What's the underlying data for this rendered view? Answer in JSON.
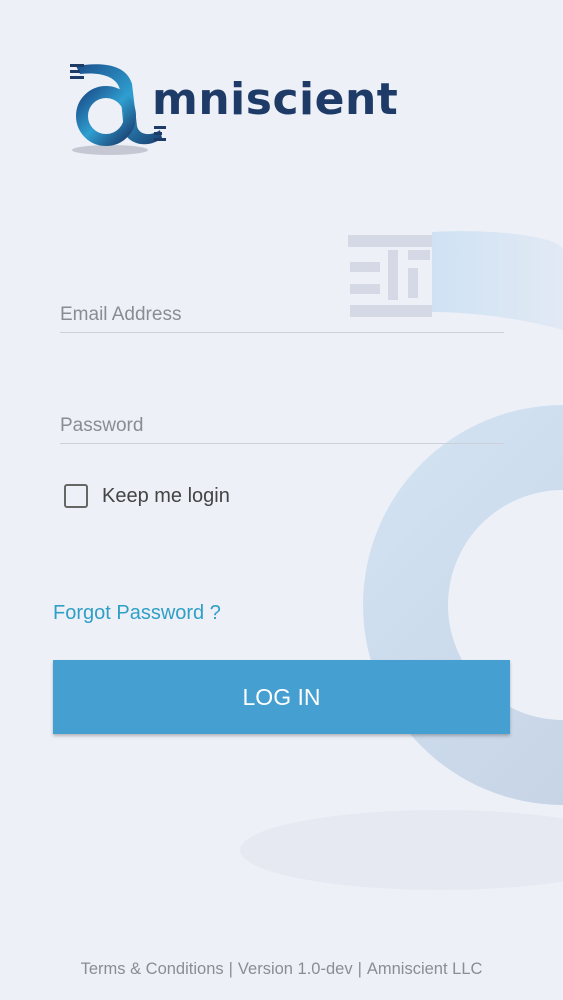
{
  "brand": {
    "wordmark": "mniscient",
    "brand_color": "#1e3a66"
  },
  "form": {
    "email_placeholder": "Email Address",
    "password_placeholder": "Password",
    "keep_login_label": "Keep me login",
    "keep_login_checked": false,
    "forgot_label": "Forgot Password ?",
    "login_label": "LOG IN"
  },
  "footer": {
    "terms_label": "Terms & Conditions",
    "version_label": "Version 1.0-dev",
    "company_label": "Amniscient LLC"
  },
  "colors": {
    "accent": "#459fd0",
    "link": "#2f9fc6",
    "background": "#eef0f8"
  }
}
